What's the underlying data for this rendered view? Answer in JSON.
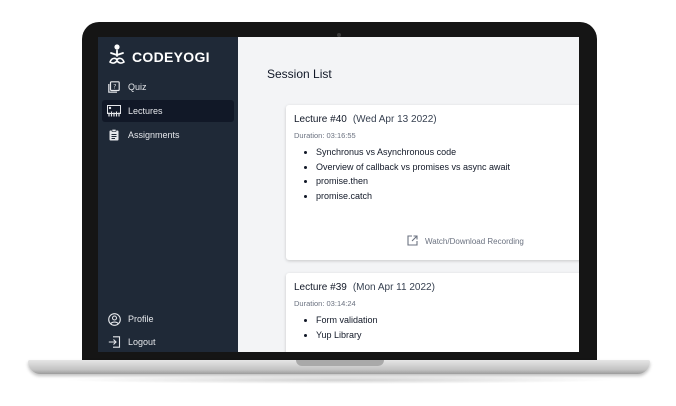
{
  "brand": {
    "name": "CODEYOGI",
    "logo_icon": "yoga-figure-icon"
  },
  "sidebar": {
    "items": [
      {
        "label": "Quiz",
        "icon": "quiz-icon"
      },
      {
        "label": "Lectures",
        "icon": "lectures-icon",
        "active": true
      },
      {
        "label": "Assignments",
        "icon": "clipboard-icon"
      }
    ],
    "bottom": [
      {
        "label": "Profile",
        "icon": "user-circle-icon"
      },
      {
        "label": "Logout",
        "icon": "logout-icon"
      }
    ]
  },
  "main": {
    "title": "Session List",
    "lectures": [
      {
        "title": "Lecture #40",
        "date": "(Wed Apr 13 2022)",
        "duration": "Duration: 03:16:55",
        "topics": [
          "Synchronus vs Asynchronous code",
          "Overview of callback vs promises vs async await",
          "promise.then",
          "promise.catch"
        ],
        "recording": "Watch/Download Recording"
      },
      {
        "title": "Lecture #39",
        "date": "(Mon Apr 11 2022)",
        "duration": "Duration: 03:14:24",
        "topics": [
          "Form validation",
          "Yup Library"
        ]
      }
    ]
  },
  "colors": {
    "sidebar_bg": "#1f2937",
    "active_item_bg": "#111827",
    "content_bg": "#f3f4f6",
    "card_bg": "#ffffff"
  }
}
